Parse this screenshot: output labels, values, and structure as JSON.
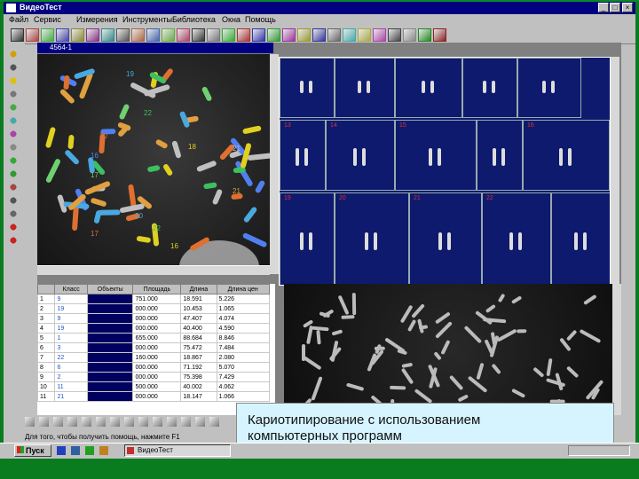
{
  "window": {
    "title": "ВидеоТест"
  },
  "menu": [
    "Файл",
    "Сервис",
    "Измерения",
    "Инструменты",
    "Библиотека",
    "Окна",
    "Помощь"
  ],
  "left_panel": {
    "title": "4564-1",
    "chromosome_labels": [
      "19",
      "22",
      "20",
      "18",
      "21",
      "16",
      "17",
      "21",
      "20",
      "22",
      "17",
      "16"
    ]
  },
  "karyogram": {
    "numbers": [
      "13",
      "14",
      "15",
      "16",
      "19",
      "20",
      "21",
      "22"
    ]
  },
  "table": {
    "headers": [
      "",
      "Класс",
      "Объекты",
      "Площадь",
      "Длина",
      "Длина цен"
    ],
    "rows": [
      [
        "1",
        "9",
        "",
        "751.000",
        "18.591",
        "5.226"
      ],
      [
        "2",
        "19",
        "",
        "000.000",
        "10.453",
        "1.065"
      ],
      [
        "3",
        "9",
        "",
        "000.000",
        "47.407",
        "4.074"
      ],
      [
        "4",
        "19",
        "",
        "000.000",
        "40.400",
        "4.590"
      ],
      [
        "5",
        "1",
        "",
        "655.000",
        "88.684",
        "8.846"
      ],
      [
        "6",
        "3",
        "",
        "000.000",
        "75.472",
        "7.484"
      ],
      [
        "7",
        "22",
        "",
        "160.000",
        "18.867",
        "2.080"
      ],
      [
        "8",
        "6",
        "",
        "000.000",
        "71.192",
        "5.070"
      ],
      [
        "9",
        "2",
        "",
        "000.000",
        "75.398",
        "7.429"
      ],
      [
        "10",
        "11",
        "",
        "500.000",
        "40.002",
        "4.062"
      ],
      [
        "11",
        "21",
        "",
        "000.000",
        "18.147",
        "1.066"
      ]
    ]
  },
  "status": {
    "hint": "Для того, чтобы получить помощь, нажмите F1"
  },
  "caption": {
    "line1": "Кариотипирование с использованием",
    "line2": "компьютерных программ"
  },
  "taskbar": {
    "start": "Пуск",
    "task": "ВидеоТест"
  },
  "colors": {
    "titlebar": "#000080",
    "desktop": "#0a7c20",
    "karyogram_bg": "#0d1a6e",
    "caption_bg": "#d6f4ff"
  }
}
